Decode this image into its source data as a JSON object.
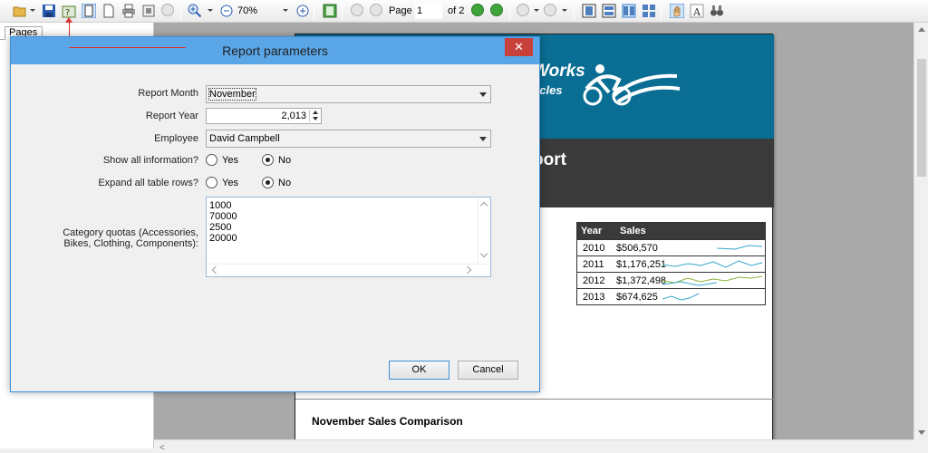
{
  "toolbar": {
    "zoom": "70%",
    "page_label": "Page",
    "page_value": "1",
    "page_of": "of 2"
  },
  "left_panel": {
    "tab": "Pages"
  },
  "dialog": {
    "title": "Report parameters",
    "close": "✕",
    "report_month_label": "Report Month",
    "report_month_value": "November",
    "report_year_label": "Report Year",
    "report_year_value": "2,013",
    "employee_label": "Employee",
    "employee_value": "David Campbell",
    "show_all_label": "Show all information?",
    "expand_rows_label": "Expand all table rows?",
    "yes": "Yes",
    "no": "No",
    "quotas_label": "Category quotas (Accessories, Bikes, Clothing, Components):",
    "quotas": [
      "1000",
      "70000",
      "2500",
      "20000"
    ],
    "ok": "OK",
    "cancel": "Cancel"
  },
  "report": {
    "brand_line1": "Works",
    "brand_line2": "ycles",
    "title_fragment": "port",
    "table_headers": [
      "Year",
      "Sales"
    ],
    "table_rows": [
      {
        "year": "2010",
        "sales": "$506,570"
      },
      {
        "year": "2011",
        "sales": "$1,176,251"
      },
      {
        "year": "2012",
        "sales": "$1,372,498"
      },
      {
        "year": "2013",
        "sales": "$674,625"
      }
    ],
    "comparison_heading": "November Sales Comparison"
  },
  "colors": {
    "banner": "#0a6e94",
    "title_bar": "#3a3a3a",
    "dialog_title": "#5aa5e6",
    "close_button": "#c7413a",
    "arrow": "#d33333"
  }
}
